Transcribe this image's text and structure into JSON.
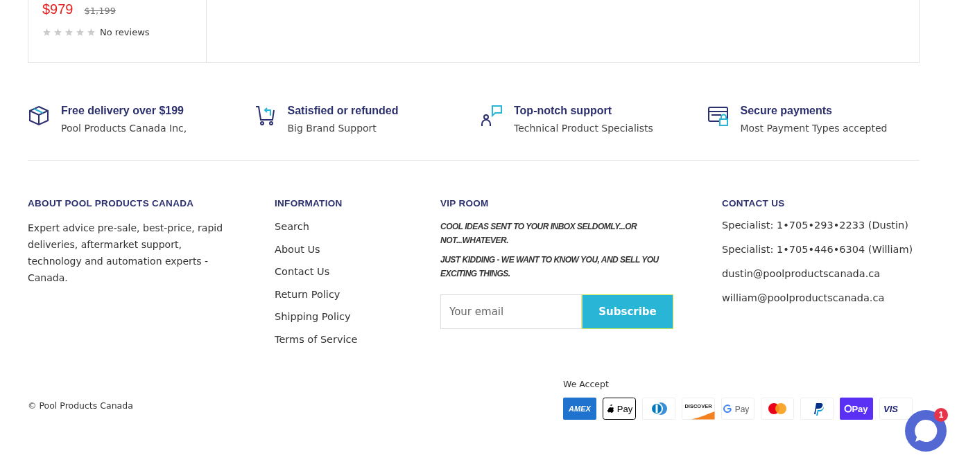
{
  "product_card": {
    "price": "$979",
    "compare_price": "$1,199",
    "stars": 0,
    "reviews": "No reviews"
  },
  "features": [
    {
      "kind": "box",
      "title": "Free delivery over $199",
      "text": "Pool Products Canada Inc,"
    },
    {
      "kind": "cart",
      "title": "Satisfied or refunded",
      "text": "Big Brand Support"
    },
    {
      "kind": "support",
      "title": "Top-notch support",
      "text": "Technical Product Specialists"
    },
    {
      "kind": "card",
      "title": "Secure payments",
      "text": "Most Payment Types accepted"
    }
  ],
  "about": {
    "title": "ABOUT POOL PRODUCTS CANADA",
    "text": "Expert advice pre-sale, best-price, rapid deliveries, aftermarket support, technology and automation experts - Canada."
  },
  "information": {
    "title": "INFORMATION",
    "links": [
      "Search",
      "About Us",
      "Contact Us",
      "Return Policy",
      "Shipping Policy",
      "Terms of Service"
    ]
  },
  "vip_room": {
    "title": "VIP ROOM",
    "lines": [
      "COOL IDEAS SENT TO YOUR INBOX SELDOMLY...OR NOT...WHATEVER.",
      "JUST KIDDING - WE WANT TO KNOW YOU,  AND SELL YOU EXCITING THINGS."
    ],
    "email": {
      "placeholder": "Your email"
    },
    "button": "Subscribe"
  },
  "contact": {
    "title": "CONTACT US",
    "lines": [
      "Specialist: 1•705•293•2233 (Dustin)",
      "Specialist: 1•705•446•6304 (William)",
      "dustin@poolproductscanada.ca",
      "william@poolproductscanada.ca"
    ]
  },
  "payments": {
    "title": "We Accept",
    "methods": [
      {
        "kind": "amex",
        "label": "AMEX"
      },
      {
        "kind": "applepay",
        "label": "Pay"
      },
      {
        "kind": "diners"
      },
      {
        "kind": "discover",
        "label": "DISCOVER"
      },
      {
        "kind": "gpay",
        "label": "Pay"
      },
      {
        "kind": "mastercard"
      },
      {
        "kind": "paypal"
      },
      {
        "kind": "shoppay",
        "label": "Pay"
      },
      {
        "kind": "visa",
        "label": "VIS"
      }
    ]
  },
  "copyright": "© Pool Products Canada",
  "chat": {
    "badge": "1"
  }
}
